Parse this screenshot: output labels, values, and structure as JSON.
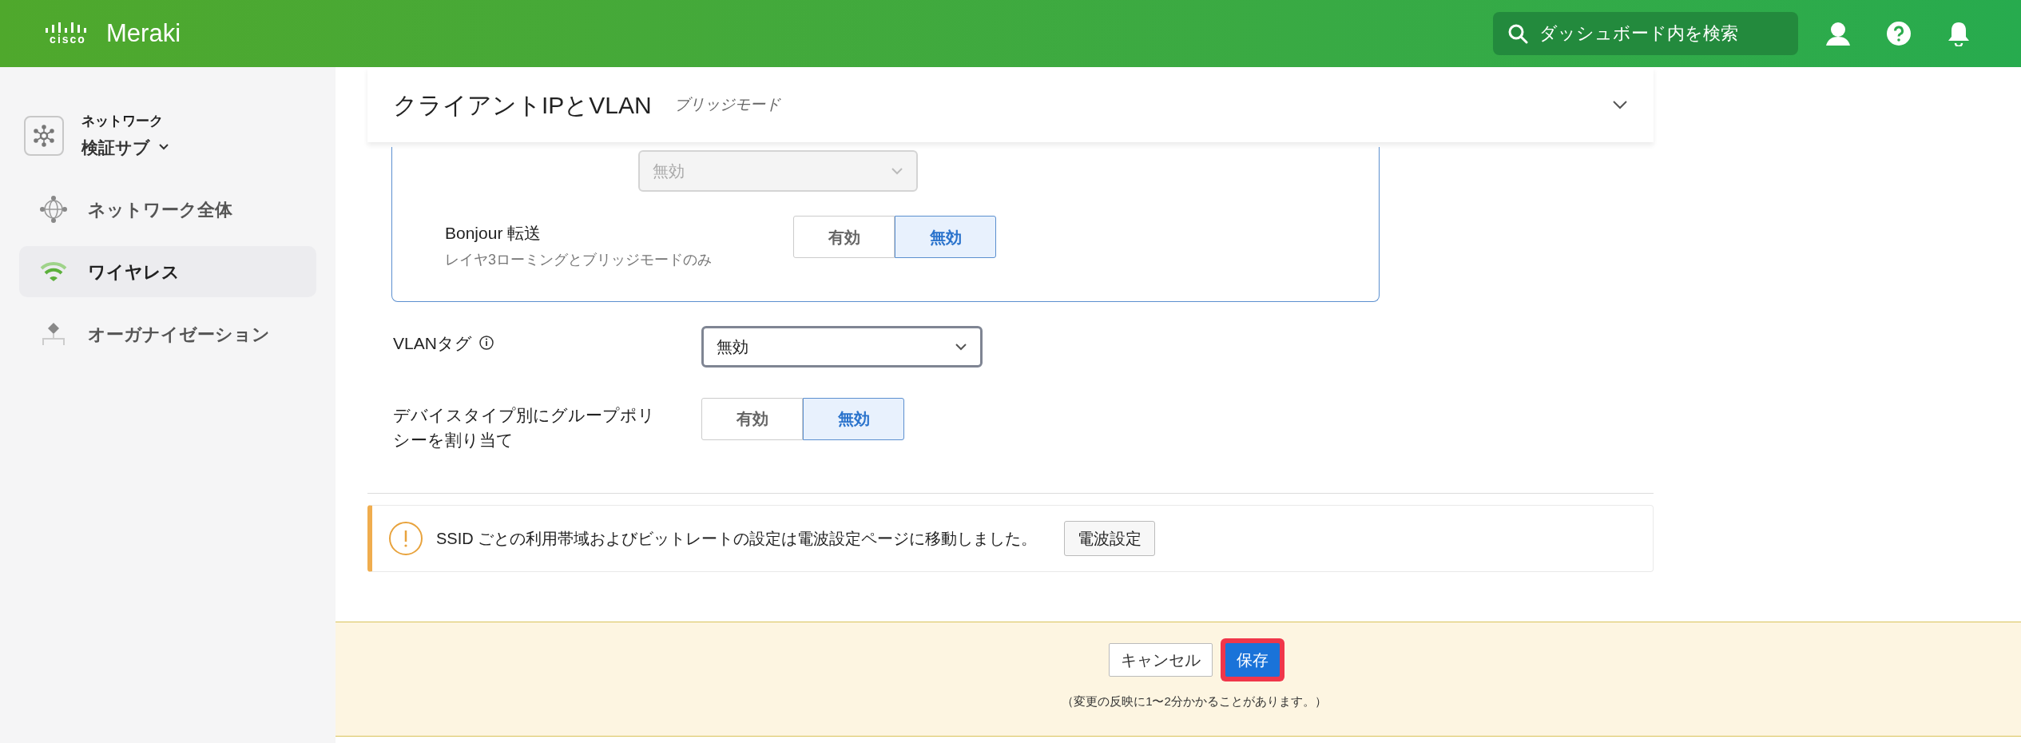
{
  "topbar": {
    "logo_mark": "cisco",
    "brand": "Meraki",
    "search": {
      "placeholder": "ダッシュボード内を検索"
    }
  },
  "sidebar": {
    "network": {
      "label": "ネットワーク",
      "name": "検証サブ"
    },
    "items": [
      {
        "label": "ネットワーク全体",
        "kind": "globe",
        "selected": false
      },
      {
        "label": "ワイヤレス",
        "kind": "wifi",
        "selected": true
      },
      {
        "label": "オーガナイゼーション",
        "kind": "org",
        "selected": false
      }
    ]
  },
  "section": {
    "title": "クライアントIPとVLAN",
    "subtitle": "ブリッジモード",
    "inner_rows": [
      {
        "kind": "select",
        "value": "無効",
        "disabled": true
      },
      {
        "kind": "toggle",
        "label": "Bonjour 転送",
        "hint": "レイヤ3ローミングとブリッジモードのみ",
        "options": [
          {
            "label": "有効",
            "selected": false
          },
          {
            "label": "無効",
            "selected": true
          }
        ]
      }
    ],
    "rows": [
      {
        "kind": "select",
        "label": "VLANタグ",
        "info": true,
        "value": "無効",
        "disabled": false
      },
      {
        "kind": "toggle",
        "label": "デバイスタイプ別にグループポリシーを割り当て",
        "options": [
          {
            "label": "有効",
            "selected": false
          },
          {
            "label": "無効",
            "selected": true
          }
        ]
      }
    ]
  },
  "notice": {
    "text": "SSID ごとの利用帯域およびビットレートの設定は電波設定ページに移動しました。",
    "button": "電波設定"
  },
  "footer": {
    "buttons": [
      {
        "label": "キャンセル",
        "kind": "secondary",
        "highlighted": false
      },
      {
        "label": "保存",
        "kind": "primary",
        "highlighted": true
      }
    ],
    "note": "（変更の反映に1〜2分かかることがあります。）"
  }
}
